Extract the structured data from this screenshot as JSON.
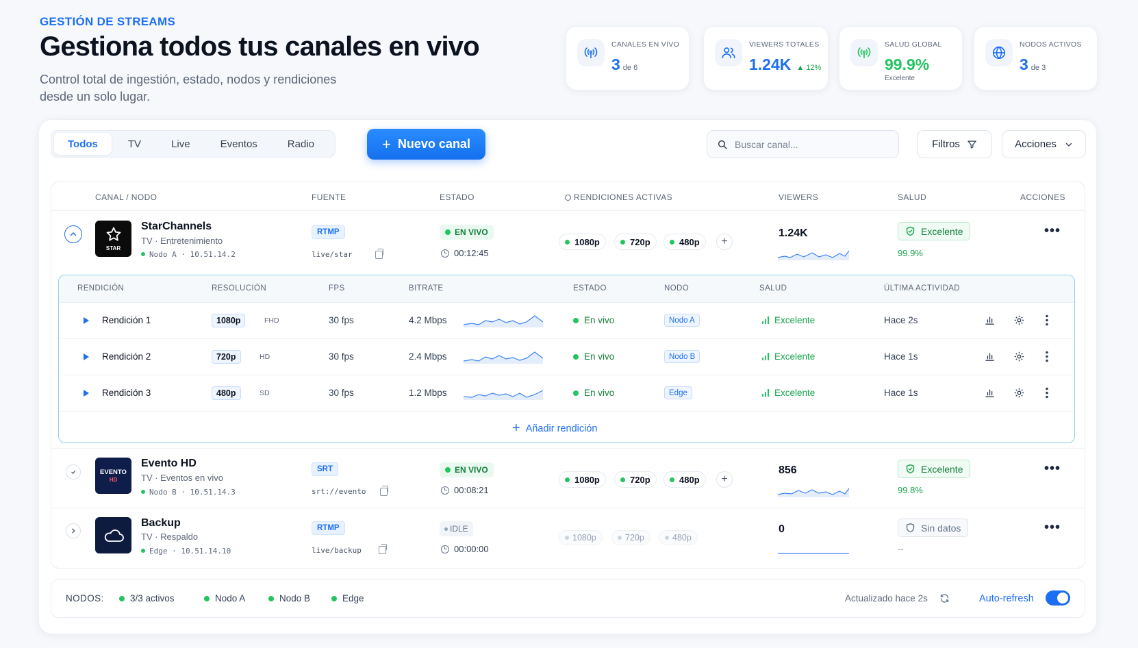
{
  "header": {
    "eyebrow": "GESTIÓN DE STREAMS",
    "title": "Gestiona todos tus canales en vivo",
    "subtitle": "Control total de ingestión, estado, nodos y rendiciones desde un solo lugar."
  },
  "stats": [
    {
      "label": "CANALES EN VIVO",
      "value": "3",
      "sub": "de 6",
      "icon": "broadcast-icon"
    },
    {
      "label": "VIEWERS TOTALES",
      "value": "1.24K",
      "trend": "▲ 12%",
      "icon": "users-icon"
    },
    {
      "label": "SALUD GLOBAL",
      "value": "99.9%",
      "note": "Excelente",
      "icon": "signal-icon"
    },
    {
      "label": "NODOS ACTIVOS",
      "value": "3",
      "sub": "de 3",
      "icon": "globe-icon"
    }
  ],
  "tabs": [
    "Todos",
    "TV",
    "Live",
    "Eventos",
    "Radio"
  ],
  "toolbar": {
    "new_channel": "Nuevo canal",
    "search_placeholder": "Buscar canal...",
    "filters": "Filtros",
    "actions": "Acciones"
  },
  "table": {
    "headers": [
      "CANAL / NODO",
      "FUENTE",
      "ESTADO",
      "RENDICIONES ACTIVAS",
      "VIEWERS",
      "SALUD",
      "ACCIONES"
    ],
    "channels": [
      {
        "name": "StarChannels",
        "category": "TV · Entretenimiento",
        "node": "Nodo A · 10.51.14.2",
        "logo_text": "STAR",
        "source": "RTMP",
        "path": "live/star",
        "status": "EN VIVO",
        "time": "00:12:45",
        "renditions": [
          "1080p",
          "720p",
          "480p"
        ],
        "viewers": "1.24K",
        "health": "Excelente",
        "health_pct": "99.9%"
      },
      {
        "name": "Evento HD",
        "category": "TV · Eventos en vivo",
        "node": "Nodo B · 10.51.14.3",
        "logo_text": "EVENTO",
        "logo_text2": "HD",
        "source": "SRT",
        "path": "srt://evento",
        "status": "EN VIVO",
        "time": "00:08:21",
        "renditions": [
          "1080p",
          "720p",
          "480p"
        ],
        "viewers": "856",
        "health": "Excelente",
        "health_pct": "99.8%"
      },
      {
        "name": "Backup",
        "category": "TV · Respaldo",
        "node": "Edge · 10.51.14.10",
        "source": "RTMP",
        "path": "live/backup",
        "status": "IDLE",
        "time": "00:00:00",
        "renditions": [
          "1080p",
          "720p",
          "480p"
        ],
        "viewers": "0",
        "health": "Sin datos",
        "health_pct": "--"
      }
    ]
  },
  "renditions": {
    "headers": [
      "RENDICIÓN",
      "RESOLUCIÓN",
      "FPS",
      "BITRATE",
      "ESTADO",
      "NODO",
      "SALUD",
      "ÚLTIMA ACTIVIDAD"
    ],
    "rows": [
      {
        "name": "Rendición 1",
        "res": "1080p",
        "quality": "FHD",
        "fps": "30 fps",
        "bitrate": "4.2 Mbps",
        "status": "En vivo",
        "node": "Nodo A",
        "health": "Excelente",
        "last": "Hace 2s"
      },
      {
        "name": "Rendición 2",
        "res": "720p",
        "quality": "HD",
        "fps": "30 fps",
        "bitrate": "2.4 Mbps",
        "status": "En vivo",
        "node": "Nodo B",
        "health": "Excelente",
        "last": "Hace 1s"
      },
      {
        "name": "Rendición 3",
        "res": "480p",
        "quality": "SD",
        "fps": "30 fps",
        "bitrate": "1.2 Mbps",
        "status": "En vivo",
        "node": "Edge",
        "health": "Excelente",
        "last": "Hace 1s"
      }
    ],
    "add": "Añadir rendición"
  },
  "footer": {
    "label": "NODOS:",
    "active": "3/3 activos",
    "nodes": [
      "Nodo A",
      "Nodo B",
      "Edge"
    ],
    "updated": "Actualizado hace 2s",
    "autorefresh": "Auto-refresh"
  },
  "colors": {
    "accent": "#1d6ff2",
    "success": "#22c55e",
    "muted": "#5b6678"
  }
}
